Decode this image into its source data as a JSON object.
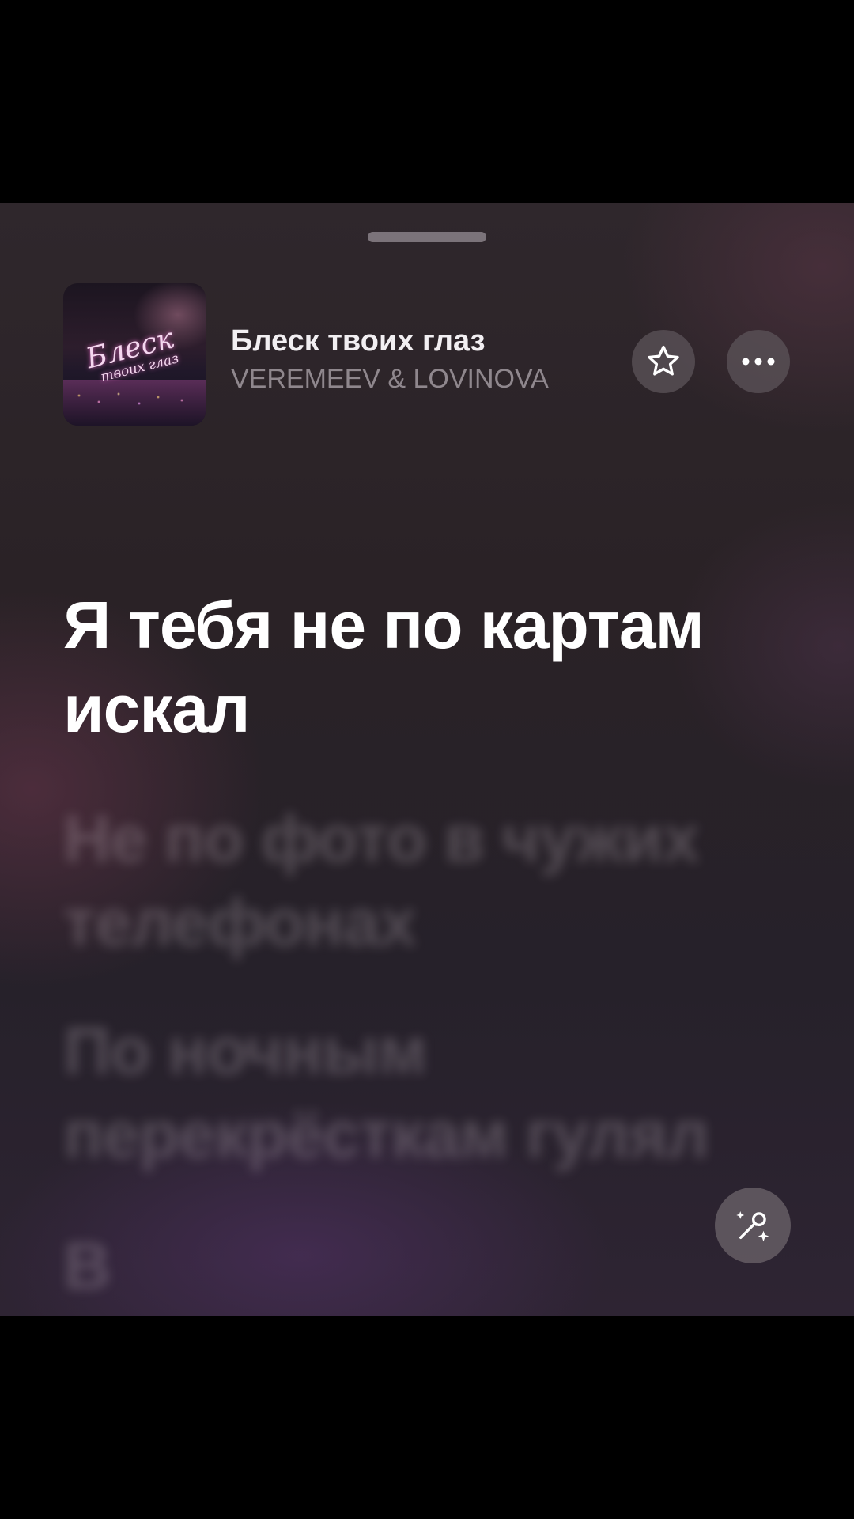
{
  "player": {
    "song_title": "Блеск твоих глаз",
    "artist": "VEREMEEV & LOVINOVA",
    "album_art": {
      "script_title": "Блеск",
      "script_subtitle": "твоих глаз"
    },
    "icons": {
      "favorite": "star-icon",
      "more": "ellipsis-icon",
      "sing": "microphone-sparkles-icon"
    }
  },
  "lyrics": {
    "current": "Я тебя не по картам искал",
    "next": "Не по фото в чужих телефонах",
    "next2": "По ночным перекрёсткам гулял",
    "next3": "В"
  },
  "colors": {
    "active_lyric": "#ffffff",
    "artist_text": "#8f878d",
    "button_bg": "#5c545a"
  }
}
